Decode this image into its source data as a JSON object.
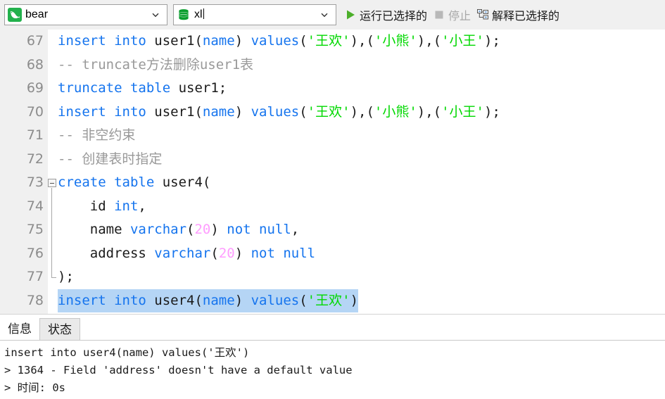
{
  "toolbar": {
    "connection": {
      "icon": "mysql-dolphin-icon",
      "value": "bear",
      "arrow_icon": "chevron-down-icon"
    },
    "database": {
      "icon": "database-icon",
      "value": "xl",
      "arrow_icon": "chevron-down-icon"
    },
    "buttons": [
      {
        "name": "run-selected",
        "label": "运行已选择的",
        "icon": "play-icon",
        "enabled": true
      },
      {
        "name": "stop",
        "label": "停止",
        "icon": "stop-icon",
        "enabled": false
      },
      {
        "name": "explain-selected",
        "label": "解释已选择的",
        "icon": "explain-plan-icon",
        "enabled": true
      }
    ]
  },
  "editor": {
    "first_line_number": 67,
    "lines": [
      {
        "number": "67",
        "tokens": [
          {
            "t": "insert into",
            "c": "kw"
          },
          {
            "t": " user1(",
            "c": "pln"
          },
          {
            "t": "name",
            "c": "kw"
          },
          {
            "t": ") ",
            "c": "pln"
          },
          {
            "t": "values",
            "c": "kw"
          },
          {
            "t": "(",
            "c": "pln"
          },
          {
            "t": "'王欢'",
            "c": "str"
          },
          {
            "t": "),(",
            "c": "pln"
          },
          {
            "t": "'小熊'",
            "c": "str"
          },
          {
            "t": "),(",
            "c": "pln"
          },
          {
            "t": "'小王'",
            "c": "str"
          },
          {
            "t": ");",
            "c": "pln"
          }
        ]
      },
      {
        "number": "68",
        "tokens": [
          {
            "t": "-- truncate方法删除user1表",
            "c": "cmt"
          }
        ]
      },
      {
        "number": "69",
        "tokens": [
          {
            "t": "truncate table",
            "c": "kw"
          },
          {
            "t": " user1;",
            "c": "pln"
          }
        ]
      },
      {
        "number": "70",
        "tokens": [
          {
            "t": "insert into",
            "c": "kw"
          },
          {
            "t": " user1(",
            "c": "pln"
          },
          {
            "t": "name",
            "c": "kw"
          },
          {
            "t": ") ",
            "c": "pln"
          },
          {
            "t": "values",
            "c": "kw"
          },
          {
            "t": "(",
            "c": "pln"
          },
          {
            "t": "'王欢'",
            "c": "str"
          },
          {
            "t": "),(",
            "c": "pln"
          },
          {
            "t": "'小熊'",
            "c": "str"
          },
          {
            "t": "),(",
            "c": "pln"
          },
          {
            "t": "'小王'",
            "c": "str"
          },
          {
            "t": ");",
            "c": "pln"
          }
        ]
      },
      {
        "number": "71",
        "tokens": [
          {
            "t": "-- 非空约束",
            "c": "cmt"
          }
        ]
      },
      {
        "number": "72",
        "tokens": [
          {
            "t": "-- 创建表时指定",
            "c": "cmt"
          }
        ]
      },
      {
        "number": "73",
        "fold": "start",
        "tokens": [
          {
            "t": "create table",
            "c": "kw"
          },
          {
            "t": " user4(",
            "c": "pln"
          }
        ]
      },
      {
        "number": "74",
        "tokens": [
          {
            "t": "    id ",
            "c": "pln"
          },
          {
            "t": "int",
            "c": "kw"
          },
          {
            "t": ",",
            "c": "pln"
          }
        ]
      },
      {
        "number": "75",
        "tokens": [
          {
            "t": "    name ",
            "c": "pln"
          },
          {
            "t": "varchar",
            "c": "kw"
          },
          {
            "t": "(",
            "c": "pln"
          },
          {
            "t": "20",
            "c": "num"
          },
          {
            "t": ") ",
            "c": "pln"
          },
          {
            "t": "not null",
            "c": "kw"
          },
          {
            "t": ",",
            "c": "pln"
          }
        ]
      },
      {
        "number": "76",
        "tokens": [
          {
            "t": "    address ",
            "c": "pln"
          },
          {
            "t": "varchar",
            "c": "kw"
          },
          {
            "t": "(",
            "c": "pln"
          },
          {
            "t": "20",
            "c": "num"
          },
          {
            "t": ") ",
            "c": "pln"
          },
          {
            "t": "not null",
            "c": "kw"
          }
        ]
      },
      {
        "number": "77",
        "fold": "end",
        "tokens": [
          {
            "t": ");",
            "c": "pln"
          }
        ]
      },
      {
        "number": "78",
        "selected": true,
        "tokens": [
          {
            "t": "insert into",
            "c": "kw"
          },
          {
            "t": " user4(",
            "c": "pln"
          },
          {
            "t": "name",
            "c": "kw"
          },
          {
            "t": ") ",
            "c": "pln"
          },
          {
            "t": "values",
            "c": "kw"
          },
          {
            "t": "(",
            "c": "pln"
          },
          {
            "t": "'王欢'",
            "c": "str"
          },
          {
            "t": ")",
            "c": "pln"
          }
        ]
      }
    ]
  },
  "bottom_panel": {
    "tabs": [
      {
        "name": "tab-info",
        "label": "信息",
        "active": true
      },
      {
        "name": "tab-status",
        "label": "状态",
        "active": false
      }
    ],
    "output_lines": [
      "insert into user4(name) values('王欢')",
      "> 1364 - Field 'address' doesn't have a default value",
      "> 时间: 0s"
    ]
  },
  "colors": {
    "keyword": "#1574ee",
    "string": "#00d800",
    "number": "#ff9dff",
    "comment": "#999999",
    "selection": "#b5d5f5",
    "toolbar_bg": "#f0f0f0",
    "gutter_bg": "#f0f0f0",
    "accent_green": "#22b14c"
  }
}
